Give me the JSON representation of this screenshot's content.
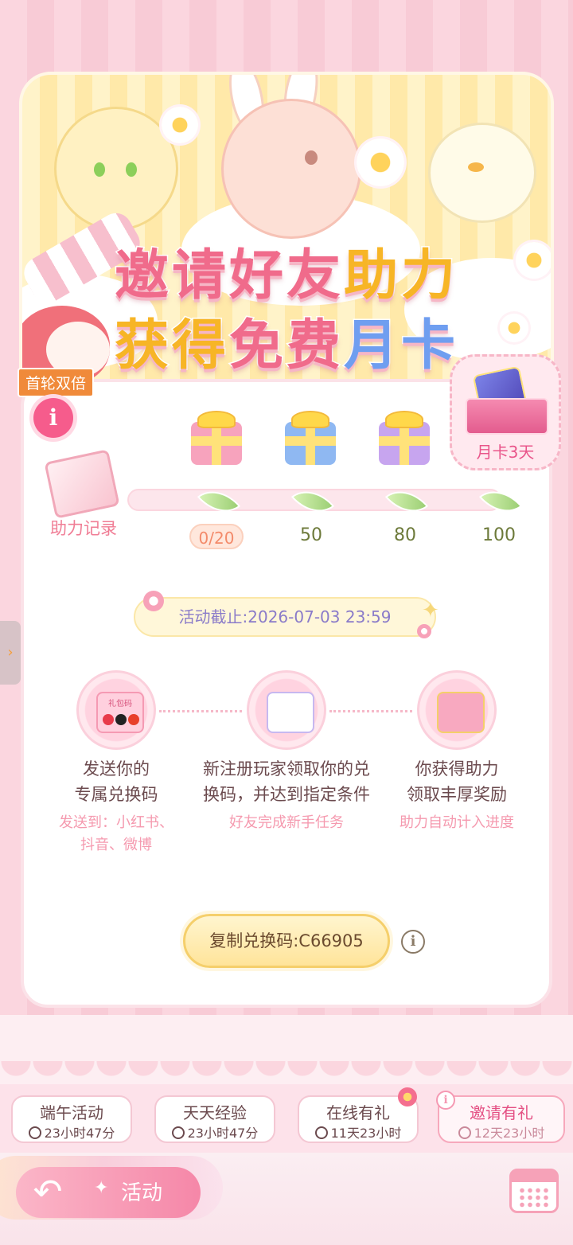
{
  "banner": {
    "title_line1_part1": "邀请好友",
    "title_line1_part2": "助力",
    "title_line2_part1": "获得",
    "title_line2_part2": "免费",
    "title_line2_part3": "月卡",
    "badge": "首轮双倍"
  },
  "progress": {
    "record_label": "助力记录",
    "current": "0/20",
    "milestones": [
      "50",
      "80",
      "100"
    ],
    "final_reward_label": "月卡3天"
  },
  "deadline": "活动截止:2026-07-03 23:59",
  "steps": [
    {
      "title_line1": "发送你的",
      "title_line2": "专属兑换码",
      "sub_line1": "发送到：小红书、",
      "sub_line2": "抖音、微博",
      "icon_text": "礼包码"
    },
    {
      "title_line1": "新注册玩家领取你的兑",
      "title_line2": "换码，并达到指定条件",
      "sub_line1": "好友完成新手任务",
      "sub_line2": ""
    },
    {
      "title_line1": "你获得助力",
      "title_line2": "领取丰厚奖励",
      "sub_line1": "助力自动计入进度",
      "sub_line2": ""
    }
  ],
  "copy_button": "复制兑换码:C66905",
  "tabs": [
    {
      "title": "端午活动",
      "time": "23小时47分"
    },
    {
      "title": "天天经验",
      "time": "23小时47分"
    },
    {
      "title": "在线有礼",
      "time": "11天23小时"
    },
    {
      "title": "邀请有礼",
      "time": "12天23小时"
    }
  ],
  "bottom_nav": {
    "activity_label": "活动"
  },
  "colors": {
    "accent_pink": "#f06b8b",
    "accent_yellow": "#f7b526",
    "accent_blue": "#6f9ef0"
  }
}
